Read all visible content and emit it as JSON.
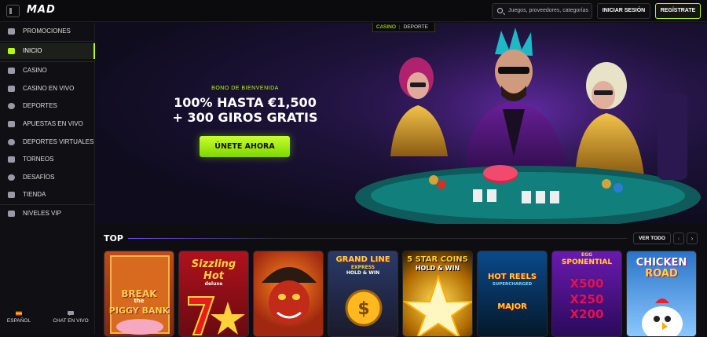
{
  "header": {
    "logo": "MAD",
    "search_placeholder": "Juegos, proveedores, categorías",
    "login_label": "INICIAR SESIÓN",
    "register_label": "REGÍSTRATE"
  },
  "sidebar": {
    "items": [
      {
        "label": "PROMOCIONES",
        "icon": "gift-icon"
      },
      {
        "label": "INICIO",
        "icon": "home-icon",
        "active": true
      },
      {
        "label": "CASINO",
        "icon": "slot-machine-icon"
      },
      {
        "label": "CASINO EN VIVO",
        "icon": "cards-icon"
      },
      {
        "label": "DEPORTES",
        "icon": "soccer-ball-icon"
      },
      {
        "label": "APUESTAS EN VIVO",
        "icon": "live-tv-icon"
      },
      {
        "label": "DEPORTES VIRTUALES",
        "icon": "gamepad-icon"
      },
      {
        "label": "TORNEOS",
        "icon": "trophy-icon"
      },
      {
        "label": "DESAFÍOS",
        "icon": "medal-icon"
      },
      {
        "label": "TIENDA",
        "icon": "shop-icon"
      },
      {
        "label": "NIVELES VIP",
        "icon": "crown-icon"
      }
    ],
    "footer": {
      "language_label": "ESPAÑOL",
      "chat_label": "CHAT EN VIVO"
    }
  },
  "banner": {
    "tabs": [
      "CASINO",
      "DEPORTE"
    ],
    "active_tab": "CASINO",
    "bonus_label": "BONO DE BIENVENIDA",
    "headline_line1": "100% HASTA €1,500",
    "headline_line2": "+ 300 GIROS GRATIS",
    "cta_label": "ÚNETE AHORA"
  },
  "top_section": {
    "title": "TOP",
    "view_all_label": "VER TODO",
    "prev_glyph": "‹",
    "next_glyph": "›",
    "games": [
      {
        "line1": "BREAK",
        "line2": "PIGGY BANK",
        "extra": "the"
      },
      {
        "line1": "Sizzling",
        "line2": "Hot",
        "extra": "deluxe"
      },
      {
        "line1": "",
        "line2": "",
        "extra": ""
      },
      {
        "line1": "GRAND LINE",
        "line2": "EXPRESS",
        "extra": "HOLD & WIN"
      },
      {
        "line1": "5 STAR COINS",
        "line2": "HOLD & WIN",
        "extra": ""
      },
      {
        "line1": "HOT REELS",
        "line2": "SUPERCHARGED",
        "extra": "MAJOR"
      },
      {
        "line1": "EGG",
        "line2": "SPONENTIAL",
        "extra": "X500 X250 X200"
      },
      {
        "line1": "CHICKEN",
        "line2": "ROAD",
        "extra": ""
      }
    ]
  },
  "colors": {
    "accent": "#b6ff00",
    "background": "#0e0e12",
    "sidebar": "#101014"
  }
}
